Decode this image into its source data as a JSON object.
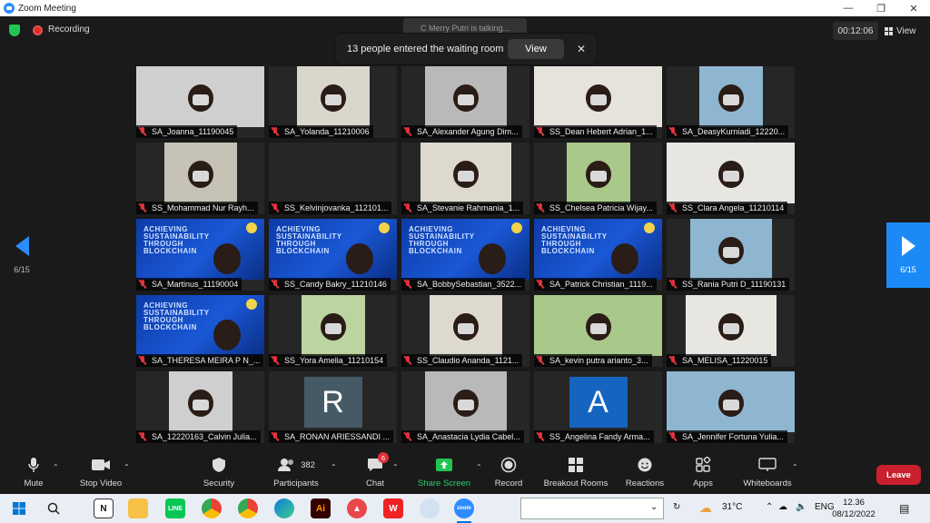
{
  "window": {
    "title": "Zoom Meeting"
  },
  "topbar": {
    "recording_label": "Recording",
    "timer": "00:12:06",
    "view_label": "View",
    "talking_text": "C Merry Putri is talking...",
    "waiting_notice": "13 people entered the waiting room",
    "waiting_view_button": "View"
  },
  "paging": {
    "left": "6/15",
    "right": "6/15"
  },
  "participants": [
    {
      "name": "SA_Joanna_11190045",
      "kind": "video"
    },
    {
      "name": "SA_Yolanda_11210006",
      "kind": "video"
    },
    {
      "name": "SA_Alexander Agung Dim...",
      "kind": "video"
    },
    {
      "name": "SS_Dean Hebert Adrian_1...",
      "kind": "video"
    },
    {
      "name": "SA_DeasyKurniadi_12220...",
      "kind": "video"
    },
    {
      "name": "SS_Mohammad Nur Rayh...",
      "kind": "video"
    },
    {
      "name": "SS_Kelvinjovanka_112101...",
      "kind": "blank"
    },
    {
      "name": "SA_Stevanie Rahmania_1...",
      "kind": "video"
    },
    {
      "name": "SS_Chelsea Patricia Wijay...",
      "kind": "video"
    },
    {
      "name": "SS_Clara Angela_11210114",
      "kind": "video"
    },
    {
      "name": "SA_Martinus_11190004",
      "kind": "banner"
    },
    {
      "name": "SS_Candy Bakry_11210146",
      "kind": "banner"
    },
    {
      "name": "SA_BobbySebastian_3522...",
      "kind": "banner"
    },
    {
      "name": "SA_Patrick Christian_1119...",
      "kind": "banner"
    },
    {
      "name": "SS_Rania Putri D_11190131",
      "kind": "video"
    },
    {
      "name": "SA_THERESA MEIRA P N_...",
      "kind": "banner"
    },
    {
      "name": "SS_Yora Amelia_11210154",
      "kind": "video"
    },
    {
      "name": "SS_Claudio Ananda_1121...",
      "kind": "video"
    },
    {
      "name": "SA_kevin putra arianto_3...",
      "kind": "video"
    },
    {
      "name": "SA_MELISA_11220015",
      "kind": "video"
    },
    {
      "name": "SA_12220163_Calvin Julia...",
      "kind": "video"
    },
    {
      "name": "SA_RONAN ARIESSANDI ...",
      "kind": "letter",
      "letter": "R"
    },
    {
      "name": "SA_Anastacia Lydia Cabel...",
      "kind": "video"
    },
    {
      "name": "SS_Angelina Fandy Arma...",
      "kind": "letter",
      "letter": "A"
    },
    {
      "name": "SA_Jennifer Fortuna Yulia...",
      "kind": "video"
    }
  ],
  "banner_text": "ACHIEVING SUSTAINABILITY THROUGH BLOCKCHAIN",
  "controls": {
    "mute": "Mute",
    "stop_video": "Stop Video",
    "security": "Security",
    "participants": "Participants",
    "participants_count": "382",
    "chat": "Chat",
    "chat_badge": "6",
    "share_screen": "Share Screen",
    "record": "Record",
    "breakout_rooms": "Breakout Rooms",
    "reactions": "Reactions",
    "apps": "Apps",
    "whiteboards": "Whiteboards",
    "leave": "Leave"
  },
  "taskbar": {
    "weather": "31°C",
    "language": "ENG",
    "time": "12.36",
    "date": "08/12/2022"
  },
  "colors": {
    "accent": "#2d8cff",
    "leave": "#c8202c",
    "share": "#23c552",
    "muted": "#e0333a"
  }
}
